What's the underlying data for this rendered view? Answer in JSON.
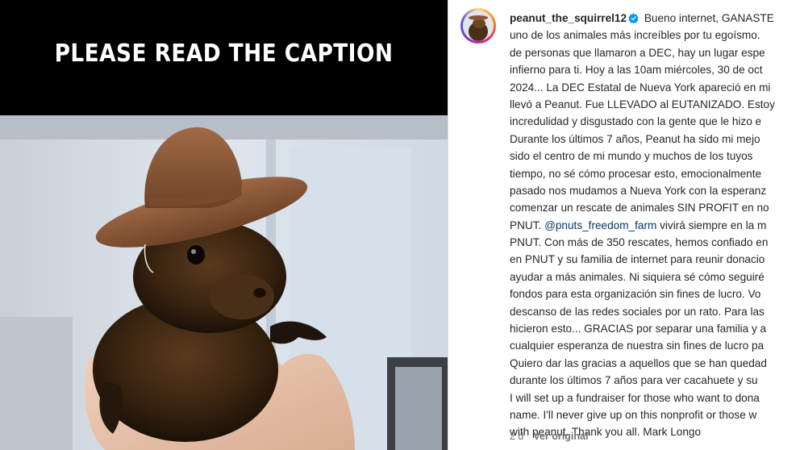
{
  "media": {
    "banner_text": "PLEASE READ THE CAPTION"
  },
  "post": {
    "username": "peanut_the_squirrel12",
    "caption_lines": [
      "Bueno internet, GANASTE",
      "uno de los animales más increíbles por tu egoísmo.",
      "de personas que llamaron a DEC, hay un lugar espe",
      "infierno para ti. Hoy a las 10am miércoles, 30 de oct",
      "2024... La DEC Estatal de Nueva York apareció en mi",
      "llevó a Peanut. Fue LLEVADO al EUTANIZADO. Estoy",
      "incredulidad y disgustado con la gente que le hizo e",
      "Durante los últimos 7 años, Peanut ha sido mi mejo",
      "sido el centro de mi mundo y muchos de los tuyos",
      "tiempo, no sé cómo procesar esto, emocionalmente",
      "pasado nos mudamos a Nueva York con la esperanz",
      "comenzar un rescate de animales SIN PROFIT en no",
      "PNUT. @pnuts_freedom_farm vivirá siempre en la m",
      "PNUT. Con más de 350 rescates, hemos confiado en",
      "en PNUT y su familia de internet para reunir donacio",
      "ayudar a más animales. Ni siquiera sé cómo seguiré",
      "fondos para esta organización sin fines de lucro. Vo",
      "descanso de las redes sociales por un rato. Para las",
      "hicieron esto... GRACIAS por separar una familia y a",
      "cualquier esperanza de nuestra sin fines de lucro pa",
      "Quiero dar las gracias a aquellos que se han quedad",
      "durante los últimos 7 años para ver cacahuete y su",
      "I will set up a fundraiser for those who want to dona",
      "name. I'll never give up on this nonprofit or those w",
      "with peanut. Thank you all. Mark Longo"
    ],
    "mention_prefix": "PNUT. ",
    "mention": "@pnuts_freedom_farm",
    "mention_suffix": " vivirá siempre en la m",
    "timestamp": "2 d",
    "see_translation": "Ver original"
  },
  "colors": {
    "link": "#00376b",
    "verified": "#0095f6",
    "muted": "#737373"
  }
}
